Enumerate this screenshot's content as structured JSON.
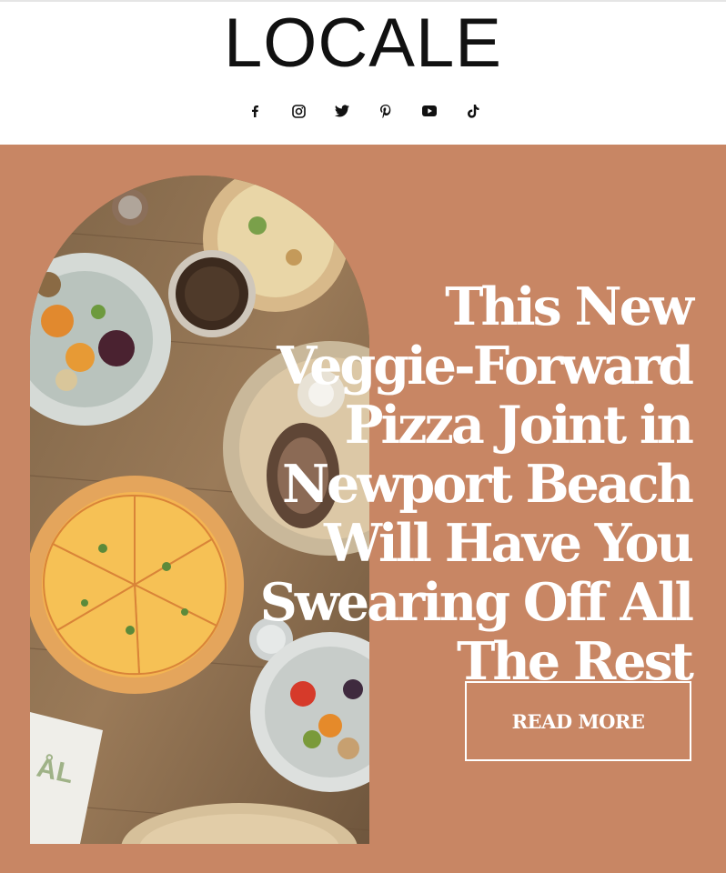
{
  "header": {
    "logo": "LOCALE",
    "social": [
      {
        "icon": "facebook-icon"
      },
      {
        "icon": "instagram-icon"
      },
      {
        "icon": "twitter-icon"
      },
      {
        "icon": "pinterest-icon"
      },
      {
        "icon": "youtube-icon"
      },
      {
        "icon": "tiktok-icon"
      }
    ]
  },
  "hero": {
    "background_color": "#c88664",
    "headline": "This New Veggie-Forward Pizza Joint in Newport Beach Will Have You Swearing Off All The Rest",
    "cta_label": "READ MORE",
    "napkin_text": "ÅL"
  }
}
